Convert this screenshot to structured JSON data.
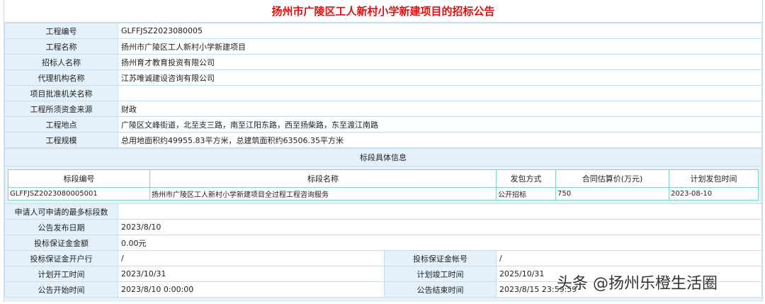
{
  "title": "扬州市广陵区工人新村小学新建项目的招标公告",
  "project": [
    {
      "label": "工程编号",
      "value": "GLFFJSZ2023080005"
    },
    {
      "label": "工程名称",
      "value": "扬州市广陵区工人新村小学新建项目"
    },
    {
      "label": "招标人名称",
      "value": "扬州育才教育投资有限公司"
    },
    {
      "label": "代理机构名称",
      "value": "江苏唯诚建设咨询有限公司"
    },
    {
      "label": "项目批准机关名称",
      "value": ""
    },
    {
      "label": "工程所须资金来源",
      "value": "财政"
    },
    {
      "label": "工程地点",
      "value": "广陵区文峰街道，北至支三路，南至江阳东路，西至扬柴路，东至渡江南路"
    },
    {
      "label": "工程规模",
      "value": "总用地面积约49955.83平方米，总建筑面积约63506.35平方米"
    }
  ],
  "section_title": "标段具体信息",
  "sections": {
    "headers": [
      "标段编号",
      "标段名称",
      "发包方式",
      "合同估算价(万元)",
      "计划发包时间"
    ],
    "rows": [
      [
        "GLFFJSZ2023080005001",
        "扬州市广陵区工人新村小学新建项目全过程工程咨询服务",
        "公开招标",
        "750",
        "2023-08-10"
      ]
    ]
  },
  "details": [
    {
      "label": "申请人可申请的最多标段数",
      "value": ""
    },
    {
      "label": "公告发布日期",
      "value": "2023/8/10"
    },
    {
      "label": "投标保证金金额",
      "value": "0.00元"
    }
  ],
  "pairs": [
    {
      "l1": "投标保证金开户行",
      "v1": "/",
      "l2": "投标保证金帐号",
      "v2": "/"
    },
    {
      "l1": "计划开工时间",
      "v1": "2023/10/31",
      "l2": "计划竣工时间",
      "v2": "2025/10/31"
    },
    {
      "l1": "公告开始时间",
      "v1": "2023/8/10 0:00:00",
      "l2": "公告结束时间",
      "v2": "2023/8/15 23:59:59"
    }
  ],
  "watermark": "头条 @扬州乐橙生活圈"
}
